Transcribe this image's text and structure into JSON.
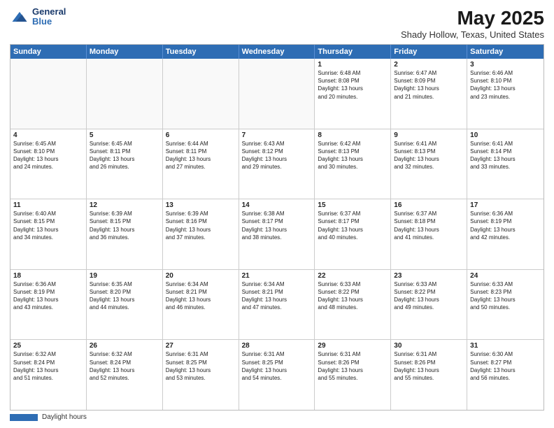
{
  "header": {
    "logo_line1": "General",
    "logo_line2": "Blue",
    "month": "May 2025",
    "location": "Shady Hollow, Texas, United States"
  },
  "weekdays": [
    "Sunday",
    "Monday",
    "Tuesday",
    "Wednesday",
    "Thursday",
    "Friday",
    "Saturday"
  ],
  "rows": [
    [
      {
        "day": "",
        "info": ""
      },
      {
        "day": "",
        "info": ""
      },
      {
        "day": "",
        "info": ""
      },
      {
        "day": "",
        "info": ""
      },
      {
        "day": "1",
        "info": "Sunrise: 6:48 AM\nSunset: 8:08 PM\nDaylight: 13 hours\nand 20 minutes."
      },
      {
        "day": "2",
        "info": "Sunrise: 6:47 AM\nSunset: 8:09 PM\nDaylight: 13 hours\nand 21 minutes."
      },
      {
        "day": "3",
        "info": "Sunrise: 6:46 AM\nSunset: 8:10 PM\nDaylight: 13 hours\nand 23 minutes."
      }
    ],
    [
      {
        "day": "4",
        "info": "Sunrise: 6:45 AM\nSunset: 8:10 PM\nDaylight: 13 hours\nand 24 minutes."
      },
      {
        "day": "5",
        "info": "Sunrise: 6:45 AM\nSunset: 8:11 PM\nDaylight: 13 hours\nand 26 minutes."
      },
      {
        "day": "6",
        "info": "Sunrise: 6:44 AM\nSunset: 8:11 PM\nDaylight: 13 hours\nand 27 minutes."
      },
      {
        "day": "7",
        "info": "Sunrise: 6:43 AM\nSunset: 8:12 PM\nDaylight: 13 hours\nand 29 minutes."
      },
      {
        "day": "8",
        "info": "Sunrise: 6:42 AM\nSunset: 8:13 PM\nDaylight: 13 hours\nand 30 minutes."
      },
      {
        "day": "9",
        "info": "Sunrise: 6:41 AM\nSunset: 8:13 PM\nDaylight: 13 hours\nand 32 minutes."
      },
      {
        "day": "10",
        "info": "Sunrise: 6:41 AM\nSunset: 8:14 PM\nDaylight: 13 hours\nand 33 minutes."
      }
    ],
    [
      {
        "day": "11",
        "info": "Sunrise: 6:40 AM\nSunset: 8:15 PM\nDaylight: 13 hours\nand 34 minutes."
      },
      {
        "day": "12",
        "info": "Sunrise: 6:39 AM\nSunset: 8:15 PM\nDaylight: 13 hours\nand 36 minutes."
      },
      {
        "day": "13",
        "info": "Sunrise: 6:39 AM\nSunset: 8:16 PM\nDaylight: 13 hours\nand 37 minutes."
      },
      {
        "day": "14",
        "info": "Sunrise: 6:38 AM\nSunset: 8:17 PM\nDaylight: 13 hours\nand 38 minutes."
      },
      {
        "day": "15",
        "info": "Sunrise: 6:37 AM\nSunset: 8:17 PM\nDaylight: 13 hours\nand 40 minutes."
      },
      {
        "day": "16",
        "info": "Sunrise: 6:37 AM\nSunset: 8:18 PM\nDaylight: 13 hours\nand 41 minutes."
      },
      {
        "day": "17",
        "info": "Sunrise: 6:36 AM\nSunset: 8:19 PM\nDaylight: 13 hours\nand 42 minutes."
      }
    ],
    [
      {
        "day": "18",
        "info": "Sunrise: 6:36 AM\nSunset: 8:19 PM\nDaylight: 13 hours\nand 43 minutes."
      },
      {
        "day": "19",
        "info": "Sunrise: 6:35 AM\nSunset: 8:20 PM\nDaylight: 13 hours\nand 44 minutes."
      },
      {
        "day": "20",
        "info": "Sunrise: 6:34 AM\nSunset: 8:21 PM\nDaylight: 13 hours\nand 46 minutes."
      },
      {
        "day": "21",
        "info": "Sunrise: 6:34 AM\nSunset: 8:21 PM\nDaylight: 13 hours\nand 47 minutes."
      },
      {
        "day": "22",
        "info": "Sunrise: 6:33 AM\nSunset: 8:22 PM\nDaylight: 13 hours\nand 48 minutes."
      },
      {
        "day": "23",
        "info": "Sunrise: 6:33 AM\nSunset: 8:22 PM\nDaylight: 13 hours\nand 49 minutes."
      },
      {
        "day": "24",
        "info": "Sunrise: 6:33 AM\nSunset: 8:23 PM\nDaylight: 13 hours\nand 50 minutes."
      }
    ],
    [
      {
        "day": "25",
        "info": "Sunrise: 6:32 AM\nSunset: 8:24 PM\nDaylight: 13 hours\nand 51 minutes."
      },
      {
        "day": "26",
        "info": "Sunrise: 6:32 AM\nSunset: 8:24 PM\nDaylight: 13 hours\nand 52 minutes."
      },
      {
        "day": "27",
        "info": "Sunrise: 6:31 AM\nSunset: 8:25 PM\nDaylight: 13 hours\nand 53 minutes."
      },
      {
        "day": "28",
        "info": "Sunrise: 6:31 AM\nSunset: 8:25 PM\nDaylight: 13 hours\nand 54 minutes."
      },
      {
        "day": "29",
        "info": "Sunrise: 6:31 AM\nSunset: 8:26 PM\nDaylight: 13 hours\nand 55 minutes."
      },
      {
        "day": "30",
        "info": "Sunrise: 6:31 AM\nSunset: 8:26 PM\nDaylight: 13 hours\nand 55 minutes."
      },
      {
        "day": "31",
        "info": "Sunrise: 6:30 AM\nSunset: 8:27 PM\nDaylight: 13 hours\nand 56 minutes."
      }
    ]
  ],
  "footer": {
    "label": "Daylight hours"
  }
}
